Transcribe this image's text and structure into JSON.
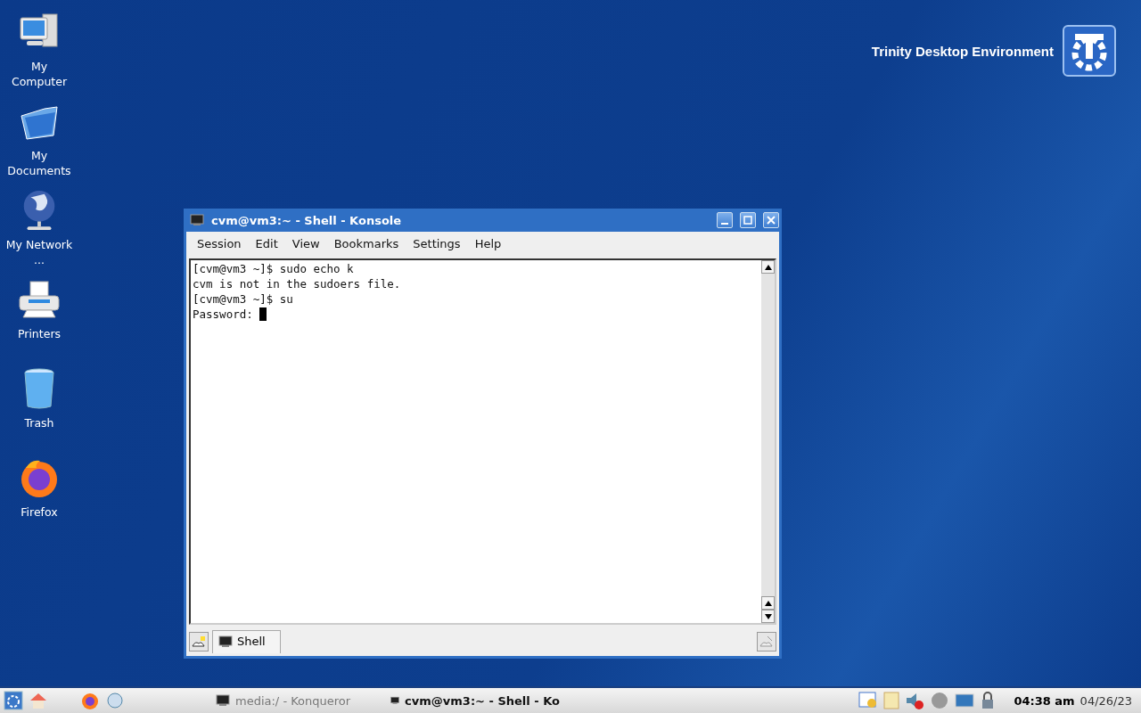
{
  "desktop_icons": [
    {
      "kind": "computer",
      "label": "My Computer"
    },
    {
      "kind": "documents",
      "label": "My Documents"
    },
    {
      "kind": "network",
      "label": "My Network ..."
    },
    {
      "kind": "printer",
      "label": "Printers"
    },
    {
      "kind": "trash",
      "label": "Trash"
    },
    {
      "kind": "firefox",
      "label": "Firefox"
    }
  ],
  "wallpaper": {
    "brand": "Trinity Desktop Environment"
  },
  "window": {
    "title": "cvm@vm3:~ - Shell - Konsole",
    "menu": [
      "Session",
      "Edit",
      "View",
      "Bookmarks",
      "Settings",
      "Help"
    ],
    "terminal_lines": [
      "[cvm@vm3 ~]$ sudo echo k",
      "cvm is not in the sudoers file.",
      "[cvm@vm3 ~]$ su",
      "Password: "
    ],
    "tabs": [
      {
        "label": "Shell",
        "selected": true
      }
    ]
  },
  "taskbar": {
    "tasks": [
      {
        "label": "media:/ - Konqueror",
        "selected": false
      },
      {
        "label": "cvm@vm3:~ - Shell - Ko",
        "selected": true
      }
    ],
    "time": "04:38 am",
    "date": "04/26/23"
  }
}
